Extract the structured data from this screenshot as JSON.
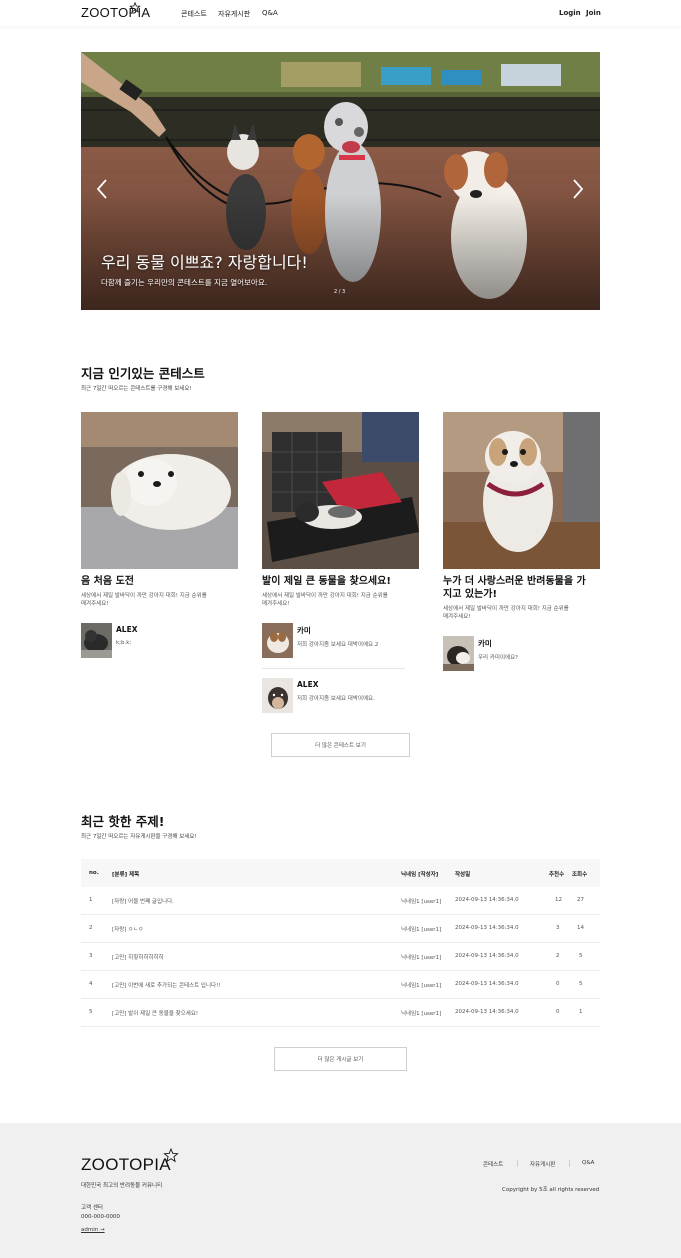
{
  "header": {
    "logo": "ZOOTOPIA",
    "nav": [
      "콘테스트",
      "자유게시판",
      "Q&A"
    ],
    "login": "Login",
    "join": "Join"
  },
  "hero": {
    "title": "우리 동물 이쁘죠? 자랑합니다!",
    "subtitle": "다함께 즐기는 우리만의 콘테스트를 지금 열어보아요.",
    "pager": "2 / 3"
  },
  "popular": {
    "title": "지금 인기있는 콘테스트",
    "subtitle": "최근 7일간 떠오르는 콘테스트를 구경해 보세요!",
    "cards": [
      {
        "title": "음 처음 도전",
        "desc1": "세상에서 제일 발바닥이 까만 강아지 대회! 지금 순위를",
        "desc2": "매겨주세요!",
        "entries": [
          {
            "name": "ALEX",
            "text": "k;b.k;"
          }
        ]
      },
      {
        "title": "발이 제일 큰 동물을 찾으세요!",
        "desc1": "세상에서 제일 발바닥이 까만 강아지 대회! 지금 순위를",
        "desc2": "매겨주세요!",
        "entries": [
          {
            "name": "카미",
            "text": "저희 강아지좀 보세요 대박이에요.2"
          },
          {
            "name": "ALEX",
            "text": "저희 강아지좀 보세요 대박이에요."
          }
        ]
      },
      {
        "title1": "누가 더 사랑스러운 반려동물을 가",
        "title2": "지고 있는가!",
        "desc1": "세상에서 제일 발바닥이 까만 강아지 대회! 지금 순위를",
        "desc2": "매겨주세요!",
        "entries": [
          {
            "name": "카미",
            "text": "우리 카미이에요?"
          }
        ]
      }
    ],
    "more_label": "더 많은 콘테스트 보기"
  },
  "hot": {
    "title": "최근 핫한 주제!",
    "subtitle": "최근 7일간 떠오르는 자유게시판을 구경해 보세요!",
    "columns": [
      "no.",
      "[분류] 제목",
      "닉네임 [작성자]",
      "작성일",
      "추천수",
      "조회수"
    ],
    "rows": [
      {
        "no": "1",
        "title": "[자랑] 어을 번째 글입니다.",
        "author": "닉네임1 [user1]",
        "date": "2024-09-13 14:36:34.0",
        "likes": "12",
        "views": "27"
      },
      {
        "no": "2",
        "title": "[자랑] ㅇㄴㅇ",
        "author": "닉네임1 [user1]",
        "date": "2024-09-13 14:36:34.0",
        "likes": "3",
        "views": "14"
      },
      {
        "no": "3",
        "title": "[고민] 히힣히히히히히",
        "author": "닉네임1 [user1]",
        "date": "2024-09-13 14:36:34.0",
        "likes": "2",
        "views": "5"
      },
      {
        "no": "4",
        "title": "[고민] 이번에 새로 추가되는 콘테스트 입니다!!",
        "author": "닉네임1 [user1]",
        "date": "2024-09-13 14:36:34.0",
        "likes": "0",
        "views": "5"
      },
      {
        "no": "5",
        "title": "[고민] 발이 제일 큰 동물을 찾으세요!",
        "author": "닉네임1 [user1]",
        "date": "2024-09-13 14:36:34.0",
        "likes": "0",
        "views": "1"
      }
    ],
    "more_label": "더 많은 게시글 보기"
  },
  "footer": {
    "logo": "ZOOTOPIA",
    "tagline": "대한민국 최고의 반려동물 커뮤니티",
    "cs_label": "고객 센터",
    "phone": "000-000-0000",
    "admin": "admin →",
    "links": [
      "콘테스트",
      "자유게시판",
      "Q&A"
    ],
    "copyright": "Copyright by 5조 all rights reserved"
  },
  "colors": {
    "footer_bg": "#f0f0f0",
    "table_header_bg": "#f7f7f7",
    "text": "#111111"
  }
}
